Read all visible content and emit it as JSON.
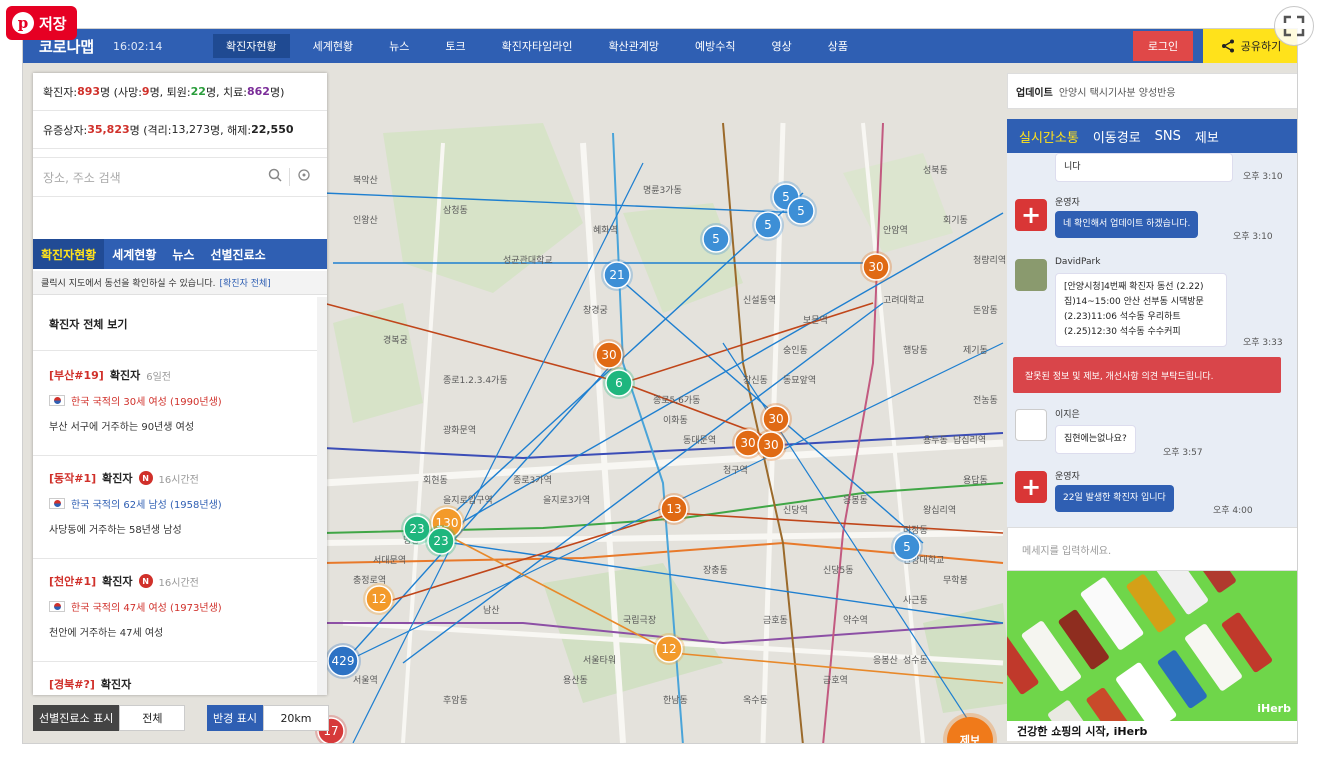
{
  "overlay": {
    "pin_save_label": "저장",
    "pin_logo": "p",
    "expand_icon": "expand-icon"
  },
  "header": {
    "brand": "코로나맵",
    "time": "16:02:14",
    "nav": [
      "확진자현황",
      "세계현황",
      "뉴스",
      "토크",
      "확진자타임라인",
      "확산관계망",
      "예방수칙",
      "영상",
      "상품"
    ],
    "active_nav_index": 0,
    "login_label": "로그인",
    "share_label": "공유하기"
  },
  "stats": {
    "line1": {
      "p1": "확진자: ",
      "confirmed": "893",
      "p2": "명 (사망: ",
      "deaths": "9",
      "p3": "명, 퇴원: ",
      "discharged": "22",
      "p4": "명, 치료: ",
      "treating": "862",
      "p5": "명)"
    },
    "line2": {
      "p1": "유증상자: ",
      "symptomatic": "35,823",
      "p2": "명 (격리: ",
      "isolated": "13,273",
      "p3": "명, 해제: ",
      "released": "22,550",
      "p4": ""
    }
  },
  "search": {
    "placeholder": "장소, 주소 검색",
    "search_icon": "search-icon",
    "locate_icon": "locate-icon"
  },
  "left_tabs": [
    "확진자현황",
    "세계현황",
    "뉴스",
    "선별진료소"
  ],
  "hint": {
    "text": "클릭시 지도에서 동선을 확인하실 수 있습니다.",
    "link": "[확진자 전체]"
  },
  "view_all_label": "확진자 전체 보기",
  "cases": [
    {
      "tag": "[부산#19]",
      "label": "확진자",
      "ago": "6일전",
      "is_new": false,
      "nationality": "한국 국적의 30세 여성 (1990년생)",
      "gender": "female",
      "desc": "부산 서구에 거주하는 90년생 여성"
    },
    {
      "tag": "[동작#1]",
      "label": "확진자",
      "ago": "16시간전",
      "is_new": true,
      "nationality": "한국 국적의 62세 남성 (1958년생)",
      "gender": "male",
      "desc": "사당동에 거주하는 58년생 남성"
    },
    {
      "tag": "[천안#1]",
      "label": "확진자",
      "ago": "16시간전",
      "is_new": true,
      "nationality": "한국 국적의 47세 여성 (1973년생)",
      "gender": "female",
      "desc": "천안에 거주하는 47세 여성"
    },
    {
      "tag": "[경북#?]",
      "label": "확진자",
      "ago": "",
      "is_new": false,
      "nationality": "",
      "gender": "female",
      "desc": ""
    }
  ],
  "new_badge": "N",
  "filters": {
    "clinic_label": "선별진료소 표시",
    "clinic_value": "전체",
    "radius_label": "반경 표시",
    "radius_value": "20km"
  },
  "map": {
    "clusters": [
      {
        "n": "5",
        "color": "#3d8fd6"
      },
      {
        "n": "5",
        "color": "#3d8fd6"
      },
      {
        "n": "5",
        "color": "#3d8fd6"
      },
      {
        "n": "5",
        "color": "#3d8fd6"
      },
      {
        "n": "21",
        "color": "#3d8fd6"
      },
      {
        "n": "30",
        "color": "#e06a14"
      },
      {
        "n": "30",
        "color": "#e06a14"
      },
      {
        "n": "6",
        "color": "#1fb67e"
      },
      {
        "n": "30",
        "color": "#e06a14"
      },
      {
        "n": "30",
        "color": "#e06a14"
      },
      {
        "n": "30",
        "color": "#e06a14"
      },
      {
        "n": "13",
        "color": "#e06a14"
      },
      {
        "n": "23",
        "color": "#1fb67e"
      },
      {
        "n": "130",
        "color": "#f39a2a"
      },
      {
        "n": "23",
        "color": "#1fb67e"
      },
      {
        "n": "12",
        "color": "#f39a2a"
      },
      {
        "n": "12",
        "color": "#f39a2a"
      },
      {
        "n": "429",
        "color": "#2c72c4"
      },
      {
        "n": "5",
        "color": "#3d8fd6"
      },
      {
        "n": "17",
        "color": "#d63a3a"
      }
    ],
    "place_labels": [
      "삼청동",
      "성균관대학교",
      "창경궁",
      "혜화역",
      "명륜3가동",
      "종로1.2.3.4가동",
      "종로5,6가동",
      "을지로3가역",
      "신당역",
      "청구역",
      "동대문역",
      "장충동",
      "남산",
      "회현동",
      "명동",
      "신당5동",
      "약수역",
      "금호동",
      "성수동",
      "왕십리역",
      "행당동",
      "고려대학교",
      "안암역",
      "성북동",
      "돈암동",
      "용두동",
      "제기동",
      "사근동",
      "무학봉",
      "응봉산",
      "창신동",
      "숭인동",
      "이화동",
      "경복궁",
      "광화문역",
      "종로3가역",
      "을지로입구역",
      "서대문역",
      "충정로역",
      "서울역",
      "후암동",
      "용산동",
      "한남동",
      "옥수동",
      "금호역",
      "한양대학교",
      "용답동",
      "답십리역",
      "전농동",
      "청량리역",
      "회기동",
      "북악산",
      "인왕산",
      "서울타워",
      "국립극장",
      "응봉동",
      "마장동",
      "신설동역",
      "보문역",
      "동묘앞역"
    ]
  },
  "right": {
    "update_label": "업데이트",
    "update_text": "안양시 택시기사분 양성반응",
    "chat_tabs": [
      "실시간소통",
      "이동경로",
      "SNS",
      "제보"
    ],
    "messages": [
      {
        "kind": "tail",
        "text": "니다",
        "time": "오후 3:10"
      },
      {
        "kind": "admin",
        "name": "운영자",
        "text": "네 확인해서 업데이트 하겠습니다.",
        "time": "오후 3:10"
      },
      {
        "kind": "user",
        "name": "DavidPark",
        "lines": [
          "[안양시청]4번째 확진자 동선 (2.22)",
          "집)14~15:00 안산 선부동 시댁방문",
          "(2.23)11:06 석수동 우리하트",
          "(2.25)12:30 석수동 수수커피"
        ],
        "time": "오후 3:33"
      },
      {
        "kind": "alert",
        "text": "잘못된 정보 및 제보, 개선사항 의견 부탁드립니다."
      },
      {
        "kind": "user2",
        "name": "이지은",
        "text": "집현에는없나요?",
        "time": "오후 3:57"
      },
      {
        "kind": "admin2",
        "name": "운영자",
        "text": "22일 발생한 확진자 입니다",
        "time": "오후 4:00"
      }
    ],
    "chat_placeholder": "메세지를 입력하세요.",
    "ad_brand": "iHerb",
    "ad_caption": "건강한 쇼핑의 시작, iHerb",
    "report_label": "제보"
  },
  "icons": {
    "share": "share-icon",
    "cross": "red-cross-icon"
  }
}
